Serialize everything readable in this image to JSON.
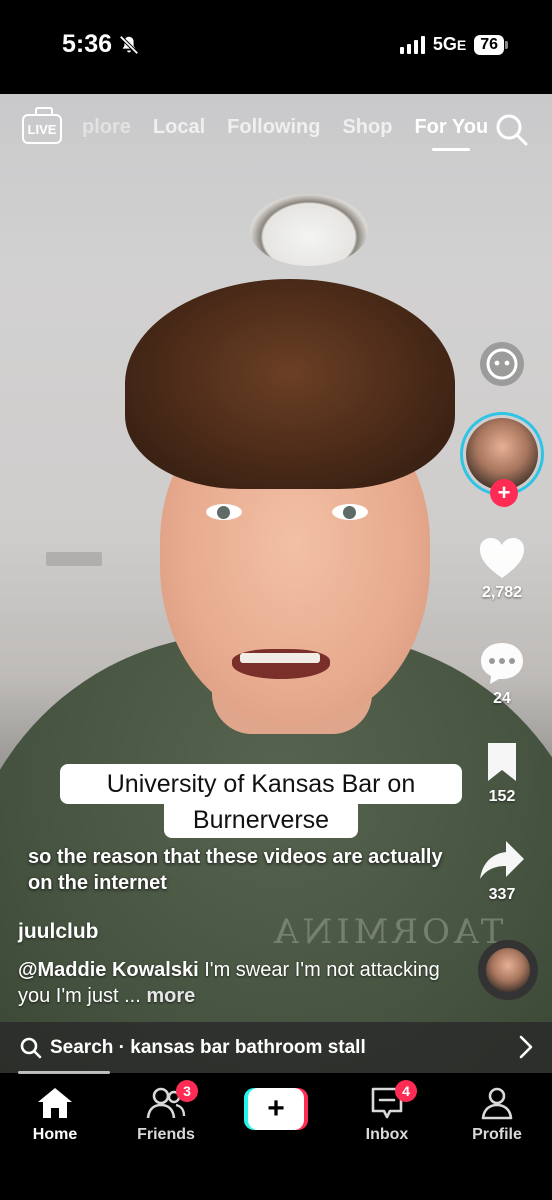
{
  "status_bar": {
    "time": "5:36",
    "network": "5G",
    "network_suffix": "E",
    "battery": "76"
  },
  "top_nav": {
    "live_label": "LIVE",
    "tabs": [
      {
        "label": "plore"
      },
      {
        "label": "Local"
      },
      {
        "label": "Following"
      },
      {
        "label": "Shop"
      },
      {
        "label": "For You"
      }
    ],
    "active_tab": "For You"
  },
  "rail": {
    "likes": "2,782",
    "comments": "24",
    "saves": "152",
    "shares": "337"
  },
  "caption": {
    "title_line1": "University of Kansas Bar on",
    "title_line2": "Burnerverse",
    "subtitle": "so the reason that these videos are actually on the internet",
    "shirt_text": "TAORMINA"
  },
  "post": {
    "author": "juulclub",
    "mention": "@Maddie Kowalski",
    "description": " I'm swear I'm not attacking you I'm just ...",
    "more": "more"
  },
  "search_suggestion": {
    "label": "Search · kansas bar bathroom stall"
  },
  "bottom_nav": {
    "home": "Home",
    "friends": "Friends",
    "friends_badge": "3",
    "inbox": "Inbox",
    "inbox_badge": "4",
    "profile": "Profile",
    "create": "+"
  },
  "colors": {
    "accent_red": "#fe2c55",
    "accent_cyan": "#25f4ee",
    "ring": "#2ec4e6"
  }
}
